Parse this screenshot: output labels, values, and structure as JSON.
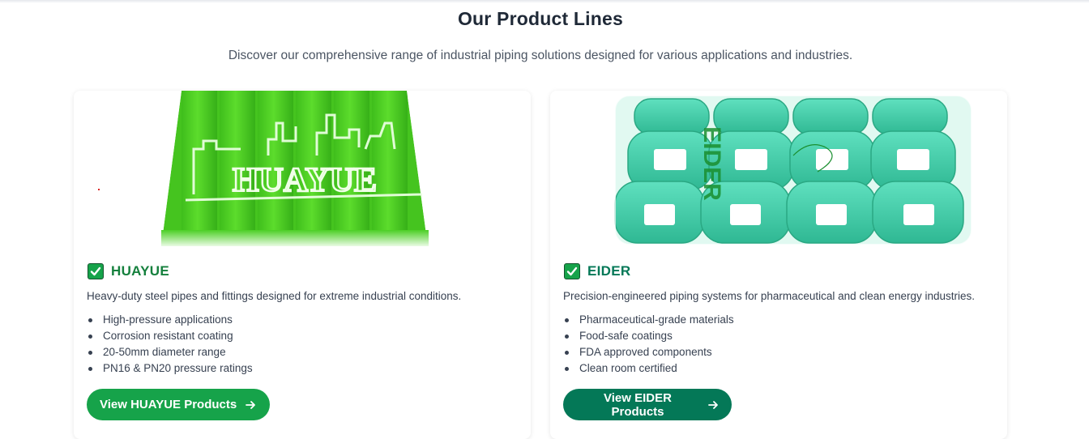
{
  "header": {
    "title": "Our Product Lines",
    "subtitle": "Discover our comprehensive range of industrial piping solutions designed for various applications and industries."
  },
  "products": [
    {
      "brand": "HUAYUE",
      "image_icon": "huayue-green-pipes",
      "image_text": "HUAYUE",
      "description": "Heavy-duty steel pipes and fittings designed for extreme industrial conditions.",
      "features": [
        "High-pressure applications",
        "Corrosion resistant coating",
        "20-50mm diameter range",
        "PN16 & PN20 pressure ratings"
      ],
      "cta_label": "View HUAYUE Products",
      "accent": "#16a34a"
    },
    {
      "brand": "EIDER",
      "image_icon": "eider-teal-fittings",
      "image_text": "EIDER",
      "description": "Precision-engineered piping systems for pharmaceutical and clean energy industries.",
      "features": [
        "Pharmaceutical-grade materials",
        "Food-safe coatings",
        "FDA approved components",
        "Clean room certified"
      ],
      "cta_label": "View EIDER Products",
      "accent": "#047857"
    }
  ]
}
